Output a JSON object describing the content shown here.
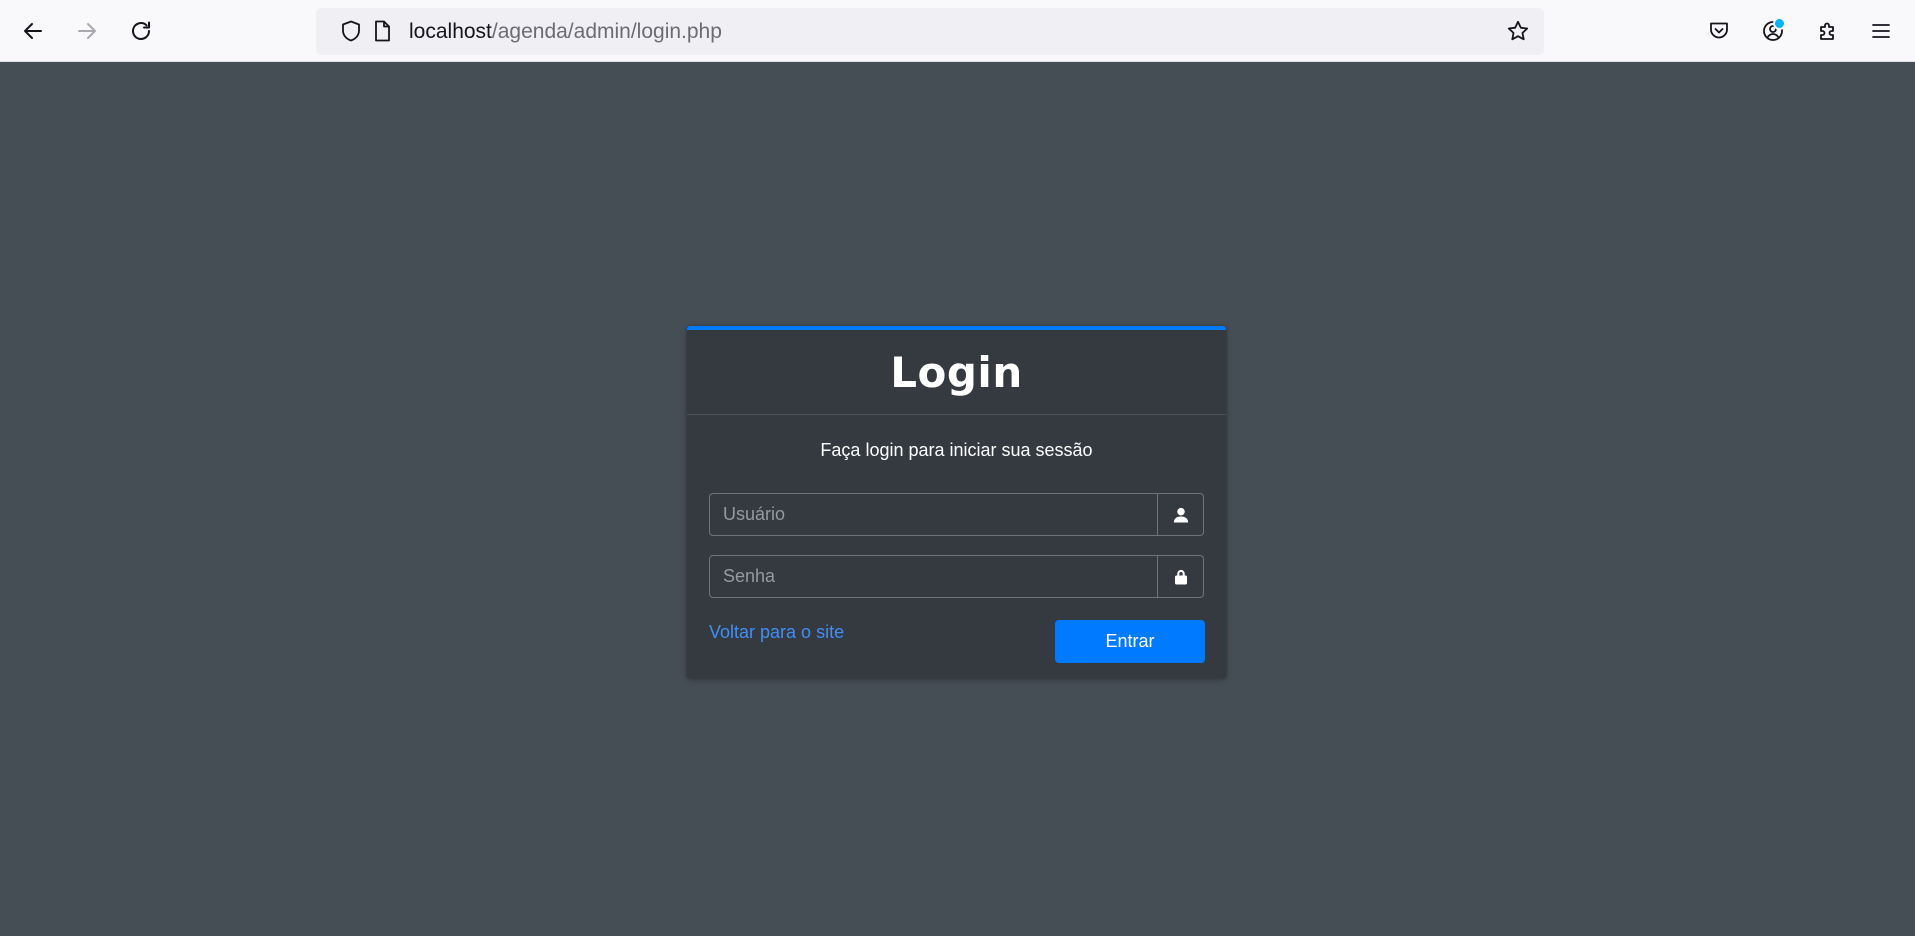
{
  "browser": {
    "url_host": "localhost",
    "url_path": "/agenda/admin/login.php"
  },
  "login": {
    "title": "Login",
    "message": "Faça login para iniciar sua sessão",
    "username_placeholder": "Usuário",
    "password_placeholder": "Senha",
    "back_link": "Voltar para o site",
    "submit_label": "Entrar"
  },
  "icons": {
    "back": "arrow-left-icon",
    "forward": "arrow-right-icon",
    "reload": "reload-icon",
    "tracking": "shield-icon",
    "page": "page-icon",
    "bookmark": "star-icon",
    "pocket": "pocket-icon",
    "account": "account-icon",
    "extensions": "puzzle-icon",
    "menu": "hamburger-menu-icon",
    "user": "user-icon",
    "lock": "lock-icon"
  },
  "colors": {
    "page_bg": "#454d55",
    "card_bg": "#343a40",
    "accent": "#007bff",
    "link": "#3f8ff7"
  }
}
